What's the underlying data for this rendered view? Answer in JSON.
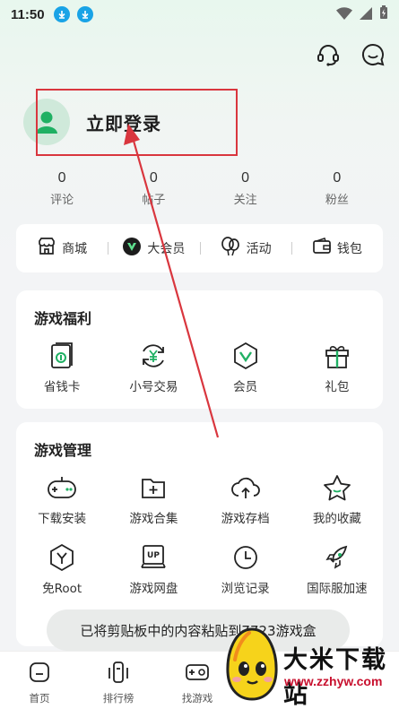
{
  "status_bar": {
    "time": "11:50"
  },
  "profile": {
    "login_label": "立即登录"
  },
  "stats": [
    {
      "value": "0",
      "label": "评论"
    },
    {
      "value": "0",
      "label": "帖子"
    },
    {
      "value": "0",
      "label": "关注"
    },
    {
      "value": "0",
      "label": "粉丝"
    }
  ],
  "shortcuts": [
    {
      "label": "商城",
      "icon": "store-icon"
    },
    {
      "label": "大会员",
      "icon": "vip-icon"
    },
    {
      "label": "活动",
      "icon": "balloon-icon"
    },
    {
      "label": "钱包",
      "icon": "wallet-icon"
    }
  ],
  "welfare": {
    "title": "游戏福利",
    "items": [
      {
        "label": "省钱卡",
        "icon": "savings-card-icon"
      },
      {
        "label": "小号交易",
        "icon": "yuan-exchange-icon"
      },
      {
        "label": "会员",
        "icon": "member-badge-icon"
      },
      {
        "label": "礼包",
        "icon": "gift-icon"
      }
    ]
  },
  "management": {
    "title": "游戏管理",
    "items": [
      {
        "label": "下载安装",
        "icon": "gamepad-icon"
      },
      {
        "label": "游戏合集",
        "icon": "folder-plus-icon"
      },
      {
        "label": "游戏存档",
        "icon": "cloud-upload-icon"
      },
      {
        "label": "我的收藏",
        "icon": "star-icon"
      },
      {
        "label": "免Root",
        "icon": "hexagon-y-icon"
      },
      {
        "label": "游戏网盘",
        "icon": "up-drive-icon"
      },
      {
        "label": "浏览记录",
        "icon": "clock-icon"
      },
      {
        "label": "国际服加速",
        "icon": "rocket-icon"
      }
    ]
  },
  "toast": {
    "text": "已将剪贴板中的内容粘贴到7723游戏盒"
  },
  "bottom_nav": [
    {
      "label": "首页",
      "icon": "home-icon"
    },
    {
      "label": "排行榜",
      "icon": "ranking-icon"
    },
    {
      "label": "找游戏",
      "icon": "find-game-icon"
    }
  ],
  "watermark": {
    "title": "大米下载站",
    "url": "www.zzhyw.com"
  },
  "colors": {
    "accent": "#1fb063",
    "annotation_red": "#d9363e"
  }
}
